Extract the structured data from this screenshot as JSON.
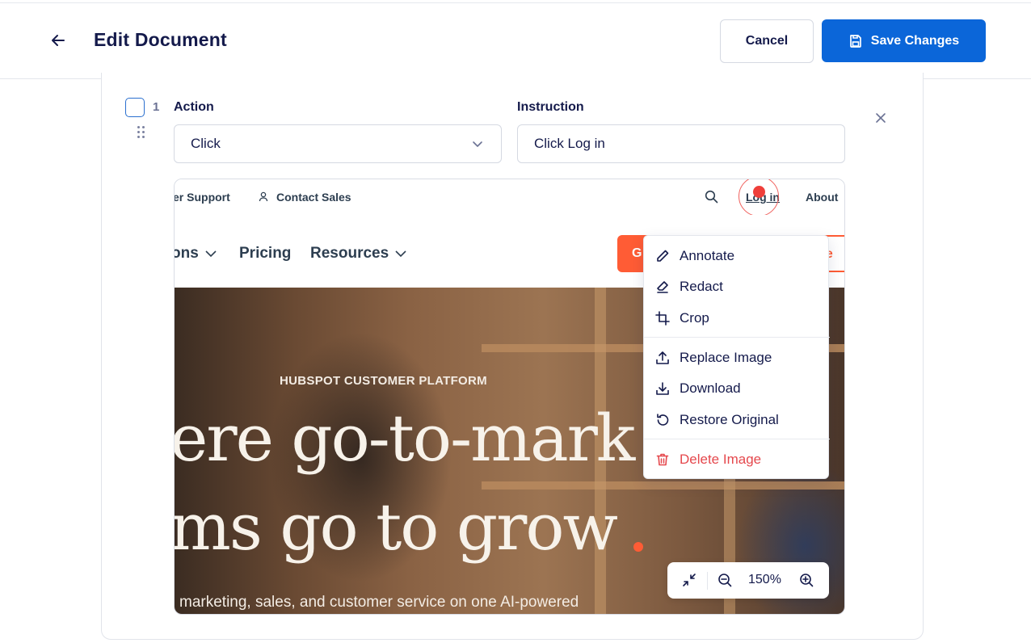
{
  "header": {
    "title": "Edit Document",
    "cancel_label": "Cancel",
    "save_label": "Save Changes"
  },
  "step": {
    "number": "1",
    "action_label": "Action",
    "action_value": "Click",
    "instruction_label": "Instruction",
    "instruction_value": "Click Log in"
  },
  "screenshot": {
    "topbar": {
      "support": "er Support",
      "contact": "Contact Sales",
      "login": "Log in",
      "about": "About"
    },
    "nav": {
      "solutions": "ons",
      "pricing": "Pricing",
      "resources": "Resources",
      "cta_primary": "G",
      "cta_secondary": "ee"
    },
    "hero": {
      "eyebrow": "HUBSPOT CUSTOMER PLATFORM",
      "line1": "ere go-to-mark",
      "line2": "ms go to grow",
      "subtitle": "marketing, sales, and customer service on one AI-powered"
    }
  },
  "image_menu": {
    "annotate": "Annotate",
    "redact": "Redact",
    "crop": "Crop",
    "replace": "Replace Image",
    "download": "Download",
    "restore": "Restore Original",
    "delete": "Delete Image"
  },
  "zoom": {
    "level": "150%"
  },
  "colors": {
    "primary": "#0b66d9",
    "danger": "#e5484d",
    "hubspot_orange": "#ff5c35",
    "click_marker": "#ef3f3a"
  }
}
